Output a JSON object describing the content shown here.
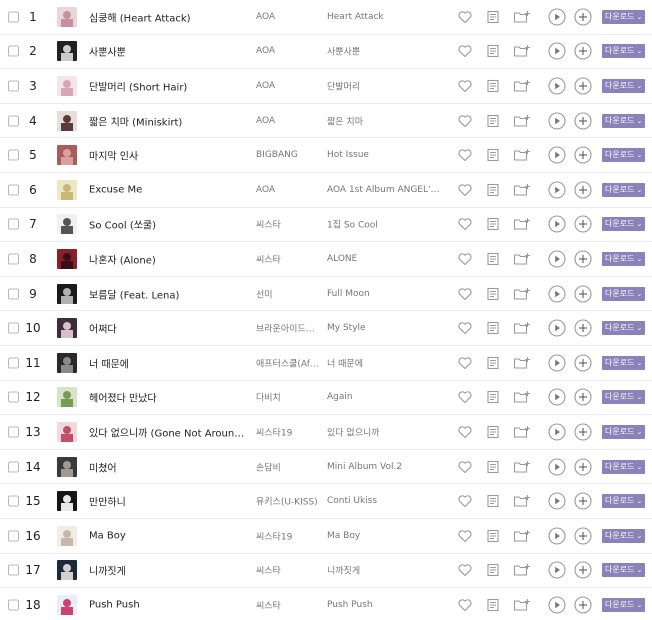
{
  "colors": {
    "download_bg": "#8a82b8",
    "icon_stroke": "#9a9a9a",
    "row_border": "#ececec"
  },
  "icons": {
    "like": "heart-icon",
    "lyrics": "lyrics-icon",
    "add_to_folder": "folder-plus-icon",
    "play": "play-icon",
    "add": "plus-icon",
    "download_caret": "chevron-down-icon"
  },
  "download_label": "다운로드",
  "songs": [
    {
      "rank": "1",
      "title": "심쿵해 (Heart Attack)",
      "artist": "AOA",
      "album": "Heart Attack",
      "thumb": [
        "#e8d6d8",
        "#c98f9e"
      ]
    },
    {
      "rank": "2",
      "title": "사뿐사뿐",
      "artist": "AOA",
      "album": "사뿐사뿐",
      "thumb": [
        "#222222",
        "#cccccc"
      ]
    },
    {
      "rank": "3",
      "title": "단발머리 (Short Hair)",
      "artist": "AOA",
      "album": "단발머리",
      "thumb": [
        "#f3e6ea",
        "#d7a5b3"
      ]
    },
    {
      "rank": "4",
      "title": "짧은 치마 (Miniskirt)",
      "artist": "AOA",
      "album": "짧은 치마",
      "thumb": [
        "#e6dede",
        "#5b3a3a"
      ]
    },
    {
      "rank": "5",
      "title": "마지막 인사",
      "artist": "BIGBANG",
      "album": "Hot Issue",
      "thumb": [
        "#a85c5c",
        "#d9a0a0"
      ]
    },
    {
      "rank": "6",
      "title": "Excuse Me",
      "artist": "AOA",
      "album": "AOA 1st Album ANGEL'S KN...",
      "thumb": [
        "#efe6c8",
        "#c8b87a"
      ]
    },
    {
      "rank": "7",
      "title": "So Cool (쏘쿨)",
      "artist": "씨스타",
      "album": "1집 So Cool",
      "thumb": [
        "#f4f0f0",
        "#555555"
      ]
    },
    {
      "rank": "8",
      "title": "나혼자 (Alone)",
      "artist": "씨스타",
      "album": "ALONE",
      "thumb": [
        "#8b1e2b",
        "#3a0e14"
      ]
    },
    {
      "rank": "9",
      "title": "보름달 (Feat. Lena)",
      "artist": "선미",
      "album": "Full Moon",
      "thumb": [
        "#1a1a1a",
        "#b0b0b0"
      ]
    },
    {
      "rank": "10",
      "title": "어쩌다",
      "artist": "브라운아이드걸...",
      "album": "My Style",
      "thumb": [
        "#3a2f3a",
        "#d8c0c8"
      ]
    },
    {
      "rank": "11",
      "title": "너 때문에",
      "artist": "애프터스쿨(Afte...",
      "album": "너 때문에",
      "thumb": [
        "#2a2a2a",
        "#8a8a8a"
      ]
    },
    {
      "rank": "12",
      "title": "헤어졌다 만났다",
      "artist": "다비치",
      "album": "Again",
      "thumb": [
        "#d8e4c8",
        "#7a9a5a"
      ]
    },
    {
      "rank": "13",
      "title": "있다 없으니까 (Gone Not Around An...",
      "artist": "씨스타19",
      "album": "있다 없으니까",
      "thumb": [
        "#f0d8dc",
        "#c0506a"
      ]
    },
    {
      "rank": "14",
      "title": "미쳤어",
      "artist": "손담비",
      "album": "Mini Album Vol.2",
      "thumb": [
        "#3a3a3a",
        "#a09a90"
      ]
    },
    {
      "rank": "15",
      "title": "만만하니",
      "artist": "유키스(U-KISS)",
      "album": "Conti Ukiss",
      "thumb": [
        "#151515",
        "#e8e8e8"
      ]
    },
    {
      "rank": "16",
      "title": "Ma Boy",
      "artist": "씨스타19",
      "album": "Ma Boy",
      "thumb": [
        "#f2ece6",
        "#c8b8a8"
      ]
    },
    {
      "rank": "17",
      "title": "니까짓게",
      "artist": "씨스타",
      "album": "니까짓게",
      "thumb": [
        "#1d2a3a",
        "#d0d0d0"
      ]
    },
    {
      "rank": "18",
      "title": "Push Push",
      "artist": "씨스타",
      "album": "Push Push",
      "thumb": [
        "#e8eef6",
        "#d04070"
      ]
    }
  ]
}
